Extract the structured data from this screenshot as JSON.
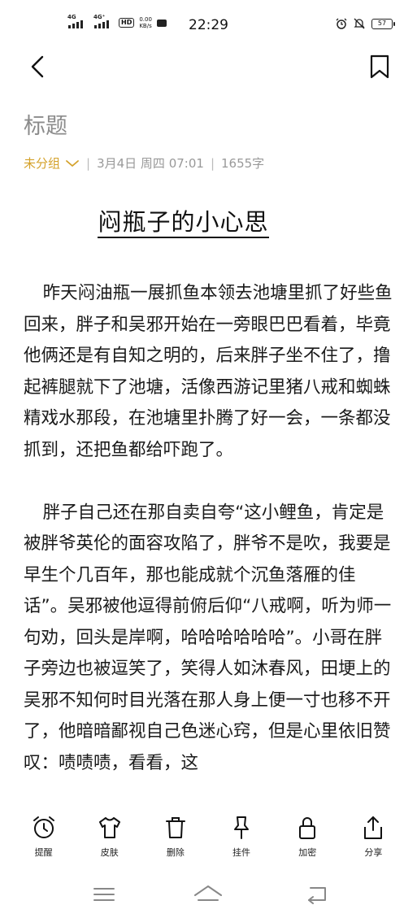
{
  "status_bar": {
    "signal1_label": "4G",
    "signal2_label": "4G⁺",
    "hd_label": "HD",
    "speed_value": "0.00",
    "speed_unit": "KB/s",
    "time": "22:29",
    "battery": "57"
  },
  "note": {
    "title_placeholder": "标题",
    "group": "未分组",
    "date": "3月4日 周四 07:01",
    "word_count": "1655字",
    "heading": "闷瓶子的小心思",
    "paragraphs": [
      "昨天闷油瓶一展抓鱼本领去池塘里抓了好些鱼回来，胖子和吴邪开始在一旁眼巴巴看着，毕竟他俩还是有自知之明的，后来胖子坐不住了，撸起裤腿就下了池塘，活像西游记里猪八戒和蜘蛛精戏水那段，在池塘里扑腾了好一会，一条都没抓到，还把鱼都给吓跑了。",
      "胖子自己还在那自卖自夸“这小鲤鱼，肯定是被胖爷英伦的面容攻陷了，胖爷不是吹，我要是早生个几百年，那也能成就个沉鱼落雁的佳话”。吴邪被他逗得前俯后仰“八戒啊，听为师一句劝，回头是岸啊，哈哈哈哈哈哈”。小哥在胖子旁边也被逗笑了，笑得人如沐春风，田埂上的吴邪不知何时目光落在那人身上便一寸也移不开了，他暗暗鄙视自己色迷心窍，但是心里依旧赞叹：啧啧啧，看看，这"
    ]
  },
  "toolbar": {
    "items": [
      {
        "label": "提醒",
        "icon": "alarm-clock-icon"
      },
      {
        "label": "皮肤",
        "icon": "shirt-icon"
      },
      {
        "label": "删除",
        "icon": "trash-icon"
      },
      {
        "label": "挂件",
        "icon": "pin-icon"
      },
      {
        "label": "加密",
        "icon": "lock-icon"
      },
      {
        "label": "分享",
        "icon": "share-icon"
      }
    ]
  },
  "colors": {
    "accent": "#d4a12a",
    "title_gray": "#8b8b8b",
    "meta_gray": "#999999"
  }
}
